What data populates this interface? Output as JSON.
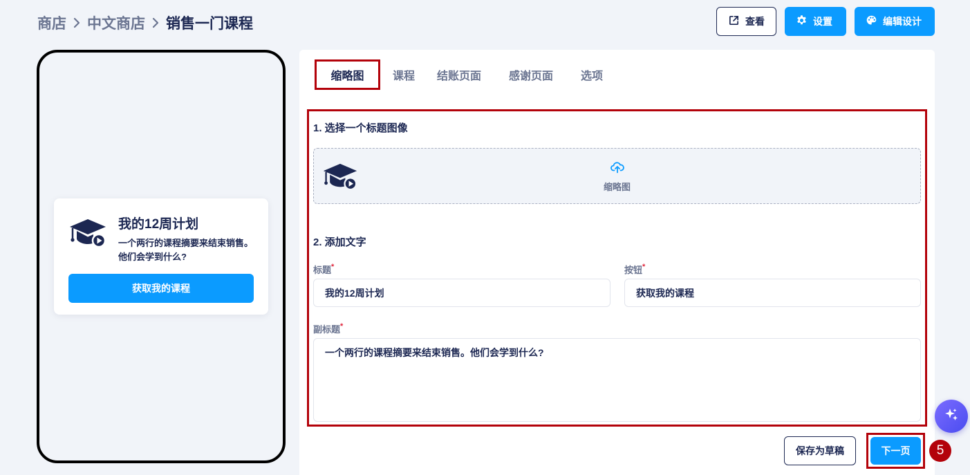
{
  "breadcrumb": [
    "商店",
    "中文商店",
    "销售一门课程"
  ],
  "header": {
    "view_label": "查看",
    "settings_label": "设置",
    "edit_design_label": "编辑设计"
  },
  "preview": {
    "title": "我的12周计划",
    "subtitle": "一个两行的课程摘要来结束销售。他们会学到什么?",
    "button": "获取我的课程"
  },
  "tabs": [
    {
      "label": "缩略图",
      "active": true
    },
    {
      "label": "课程",
      "active": false
    },
    {
      "label": "结账页面",
      "active": false
    },
    {
      "label": "感谢页面",
      "active": false
    },
    {
      "label": "选项",
      "active": false
    }
  ],
  "form": {
    "section1_title": "1. 选择一个标题图像",
    "upload_label": "缩略图",
    "section2_title": "2. 添加文字",
    "title_label": "标题",
    "title_value": "我的12周计划",
    "button_label": "按钮",
    "button_value": "获取我的课程",
    "subtitle_label": "副标题",
    "subtitle_value": "一个两行的课程摘要来结束销售。他们会学到什么?",
    "required_mark": "*"
  },
  "footer": {
    "save_draft_label": "保存为草稿",
    "next_label": "下一页",
    "step_number": "5"
  },
  "colors": {
    "primary": "#0b9bff",
    "navy": "#1c2752",
    "highlight": "#b3020a"
  },
  "icons": {
    "view": "external-link-icon",
    "settings": "gear-icon",
    "edit_design": "palette-icon",
    "course": "graduation-cap-play-icon",
    "upload": "cloud-upload-icon",
    "ai": "sparkle-icon"
  }
}
